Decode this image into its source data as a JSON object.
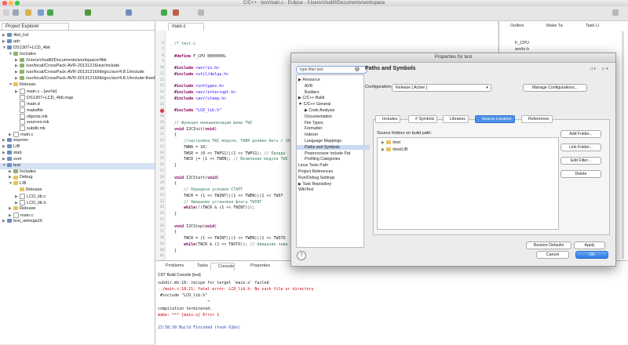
{
  "window": {
    "title": "C/C++ - test/main.c - Eclipse - /Users/chudi0/Documents/workspace"
  },
  "project_explorer": {
    "tab_label": "Project Explorer",
    "items": [
      {
        "label": "4bit_lcd",
        "depth": 0,
        "arrow": "▶",
        "icon": "proj"
      },
      {
        "label": "adc",
        "depth": 0,
        "arrow": "▶",
        "icon": "proj"
      },
      {
        "label": "DS1307+LCD_4bit",
        "depth": 0,
        "arrow": "▼",
        "icon": "proj"
      },
      {
        "label": "Includes",
        "depth": 1,
        "arrow": "▼",
        "icon": "inc"
      },
      {
        "label": "/Users/chudi0/Documents/workspace/4lib",
        "depth": 2,
        "arrow": "▶",
        "icon": "inc"
      },
      {
        "label": "/usr/local/CrossPack-AVR-20131216/avr/include",
        "depth": 2,
        "arrow": "▶",
        "icon": "inc"
      },
      {
        "label": "/usr/local/CrossPack-AVR-20131216/lib/gcc/avr/4.8.1/include",
        "depth": 2,
        "arrow": "▶",
        "icon": "inc"
      },
      {
        "label": "/usr/local/CrossPack-AVR-20131216/lib/gcc/avr/4.8.1/include-fixed",
        "depth": 2,
        "arrow": "▶",
        "icon": "inc"
      },
      {
        "label": "Release",
        "depth": 1,
        "arrow": "▼",
        "icon": "folder"
      },
      {
        "label": "main.c - [avr/le]",
        "depth": 2,
        "arrow": "▶",
        "icon": "file"
      },
      {
        "label": "DS1307+LCD_4bit.map",
        "depth": 2,
        "arrow": "",
        "icon": "file"
      },
      {
        "label": "main.d",
        "depth": 2,
        "arrow": "",
        "icon": "file"
      },
      {
        "label": "makefile",
        "depth": 2,
        "arrow": "",
        "icon": "file"
      },
      {
        "label": "objects.mk",
        "depth": 2,
        "arrow": "",
        "icon": "file"
      },
      {
        "label": "sources.mk",
        "depth": 2,
        "arrow": "",
        "icon": "file"
      },
      {
        "label": "subdir.mk",
        "depth": 2,
        "arrow": "",
        "icon": "file"
      },
      {
        "label": "main.c",
        "depth": 1,
        "arrow": "▶",
        "icon": "file"
      },
      {
        "label": "eeprom",
        "depth": 0,
        "arrow": "▶",
        "icon": "proj"
      },
      {
        "label": "LIB",
        "depth": 0,
        "arrow": "▶",
        "icon": "proj"
      },
      {
        "label": "stab",
        "depth": 0,
        "arrow": "▶",
        "icon": "proj"
      },
      {
        "label": "svet",
        "depth": 0,
        "arrow": "▶",
        "icon": "proj"
      },
      {
        "label": "test",
        "depth": 0,
        "arrow": "▼",
        "icon": "proj",
        "selected": true
      },
      {
        "label": "Includes",
        "depth": 1,
        "arrow": "▶",
        "icon": "inc"
      },
      {
        "label": "Debug",
        "depth": 1,
        "arrow": "▶",
        "icon": "folder"
      },
      {
        "label": "LIB",
        "depth": 1,
        "arrow": "▼",
        "icon": "folder"
      },
      {
        "label": "Release",
        "depth": 2,
        "arrow": "",
        "icon": "folder"
      },
      {
        "label": "LCD_lib.c",
        "depth": 2,
        "arrow": "▶",
        "icon": "file"
      },
      {
        "label": "LCD_lib.h",
        "depth": 2,
        "arrow": "▶",
        "icon": "file"
      },
      {
        "label": "Release",
        "depth": 1,
        "arrow": "▶",
        "icon": "folder"
      },
      {
        "label": "main.c",
        "depth": 1,
        "arrow": "▶",
        "icon": "file"
      },
      {
        "label": "test_atmega16",
        "depth": 0,
        "arrow": "▶",
        "icon": "proj"
      }
    ]
  },
  "editor": {
    "tab_label": "main.c",
    "lines": [
      {
        "n": "6",
        "html": "<span class=\"cm\">/* test.c</span>"
      },
      {
        "n": "7",
        "html": ""
      },
      {
        "n": "8",
        "html": "<span class=\"kw\">#define</span> F_CPU 8000000L"
      },
      {
        "n": "9",
        "html": ""
      },
      {
        "n": "10",
        "html": "<span class=\"kw\">#include</span> <span class=\"st\">&lt;avr/io.h&gt;</span>"
      },
      {
        "n": "11",
        "html": "<span class=\"kw\">#include</span> <span class=\"st\">&lt;util/delay.h&gt;</span>"
      },
      {
        "n": "12",
        "html": ""
      },
      {
        "n": "13",
        "html": "<span class=\"kw\">#include</span> <span class=\"st\">&lt;inttypes.h&gt;</span>"
      },
      {
        "n": "14",
        "html": "<span class=\"kw\">#include</span> <span class=\"st\">&lt;avr/interrupt.h&gt;</span>"
      },
      {
        "n": "15",
        "html": "<span class=\"kw\">#include</span> <span class=\"st\">&lt;avr/sleep.h&gt;</span>"
      },
      {
        "n": "16",
        "html": ""
      },
      {
        "n": "17",
        "html": "<span class=\"kw\">#include</span> <span class=\"st\">\"LCD_lib.h\"</span>",
        "err": true
      },
      {
        "n": "18",
        "html": ""
      },
      {
        "n": "19",
        "html": "<span class=\"cm\">// Функция инициализации шины TWI</span>"
      },
      {
        "n": "20",
        "html": "<span class=\"kw\">void</span> I2CInit(<span class=\"kw\">void</span>)"
      },
      {
        "n": "21",
        "html": "{"
      },
      {
        "n": "22",
        "html": "    <span class=\"cm\">//настройка TWI модуля, TWBR должен быть &gt; 10</span>"
      },
      {
        "n": "23",
        "html": "    TWBR = 10;"
      },
      {
        "n": "24",
        "html": "    TWSR = (0 &lt;&lt; TWPS1)|(1 &lt;&lt; TWPS1); <span class=\"cm\">// Предде</span>"
      },
      {
        "n": "25",
        "html": "    TWCR |= (1 &lt;&lt; TWEN); <span class=\"cm\">// Включение модуля TWI</span>"
      },
      {
        "n": "26",
        "html": "}"
      },
      {
        "n": "27",
        "html": ""
      },
      {
        "n": "28",
        "html": "<span class=\"kw\">void</span> I2CStart(<span class=\"kw\">void</span>)"
      },
      {
        "n": "29",
        "html": "{"
      },
      {
        "n": "30",
        "html": "    <span class=\"cm\">// Передача условия СТАРТ</span>"
      },
      {
        "n": "31",
        "html": "    TWCR = (1 &lt;&lt; TWINT)|(1 &lt;&lt; TWEN)|(1 &lt;&lt; TWST"
      },
      {
        "n": "32",
        "html": "    <span class=\"cm\">// Ожидание установки флага TWINT</span>"
      },
      {
        "n": "33",
        "html": "    <span class=\"kw\">while</span>(!(TWCR &amp; (1 &lt;&lt; TWINT)));"
      },
      {
        "n": "34",
        "html": "}"
      },
      {
        "n": "35",
        "html": ""
      },
      {
        "n": "36",
        "html": "<span class=\"kw\">void</span> I2CStop(<span class=\"kw\">void</span>)"
      },
      {
        "n": "37",
        "html": "{"
      },
      {
        "n": "38",
        "html": "    TWCR = (1 &lt;&lt; TWINT)|(1 &lt;&lt; TWEN)|(1 &lt;&lt; TWSTO"
      },
      {
        "n": "39",
        "html": "    <span class=\"kw\">while</span>(TWCR &amp; (1 &lt;&lt; TWSTO)); <span class=\"cm\">// Ожидание заве</span>"
      },
      {
        "n": "40",
        "html": "}"
      },
      {
        "n": "41",
        "html": ""
      },
      {
        "n": "42",
        "html": "    <span class=\"cm\">// Функция записи данных по шине</span>"
      }
    ]
  },
  "outline": {
    "tabs": [
      "Outline",
      "Make Ta",
      "Task Li"
    ],
    "items": [
      "F_CPU",
      "avr/io.h"
    ]
  },
  "console": {
    "tabs": [
      "Problems",
      "Tasks",
      "Console",
      "Properties"
    ],
    "header": "CDT Build Console [test]",
    "lines": [
      {
        "text": "subdir.mk:18: recipe for target 'main.o' failed",
        "cls": ""
      },
      {
        "text": "../main.c:18:21: fatal error: LCD_lib.h: No such file or directory",
        "cls": "red"
      },
      {
        "text": " #include \"LCD_lib.h\"",
        "cls": ""
      },
      {
        "text": "                     ^",
        "cls": ""
      },
      {
        "text": "compilation terminated.",
        "cls": ""
      },
      {
        "text": "make: *** [main.o] Error 1",
        "cls": "red"
      },
      {
        "text": "",
        "cls": ""
      },
      {
        "text": "23:58:30 Build Finished (took 62ms)",
        "cls": "blue"
      }
    ]
  },
  "dialog": {
    "title": "Properties for test",
    "filter_placeholder": "type filter text",
    "tree": [
      {
        "label": "▶ Resource",
        "indent": 0
      },
      {
        "label": "AVR",
        "indent": 1
      },
      {
        "label": "Builders",
        "indent": 1
      },
      {
        "label": "▶ C/C++ Build",
        "indent": 0
      },
      {
        "label": "▼ C/C++ General",
        "indent": 0
      },
      {
        "label": "▶ Code Analysis",
        "indent": 1
      },
      {
        "label": "Documentation",
        "indent": 1
      },
      {
        "label": "File Types",
        "indent": 1
      },
      {
        "label": "Formatter",
        "indent": 1
      },
      {
        "label": "Indexer",
        "indent": 1
      },
      {
        "label": "Language Mappings",
        "indent": 1
      },
      {
        "label": "Paths and Symbols",
        "indent": 1,
        "selected": true
      },
      {
        "label": "Preprocessor Include Pat",
        "indent": 1
      },
      {
        "label": "Profiling Categories",
        "indent": 1
      },
      {
        "label": "Linux Tools Path",
        "indent": 0
      },
      {
        "label": "Project References",
        "indent": 0
      },
      {
        "label": "Run/Debug Settings",
        "indent": 0
      },
      {
        "label": "▶ Task Repository",
        "indent": 0
      },
      {
        "label": "WikiText",
        "indent": 0
      }
    ],
    "heading": "Paths and Symbols",
    "configuration_label": "Configuration:",
    "configuration_value": "Release  [ Active ]",
    "manage_button": "Manage Configurations...",
    "tabs": [
      "Includes",
      "# Symbols",
      "Libraries",
      "Source Location",
      "References"
    ],
    "active_tab": 3,
    "source_label": "Source folders on build path:",
    "source_folders": [
      "/test",
      "/test/LIB"
    ],
    "side_buttons": [
      "Add Folder...",
      "Link Folder...",
      "Edit Filter...",
      "Delete"
    ],
    "restore_button": "Restore Defaults",
    "apply_button": "Apply",
    "cancel_button": "Cancel",
    "ok_button": "OK",
    "help_label": "?"
  }
}
